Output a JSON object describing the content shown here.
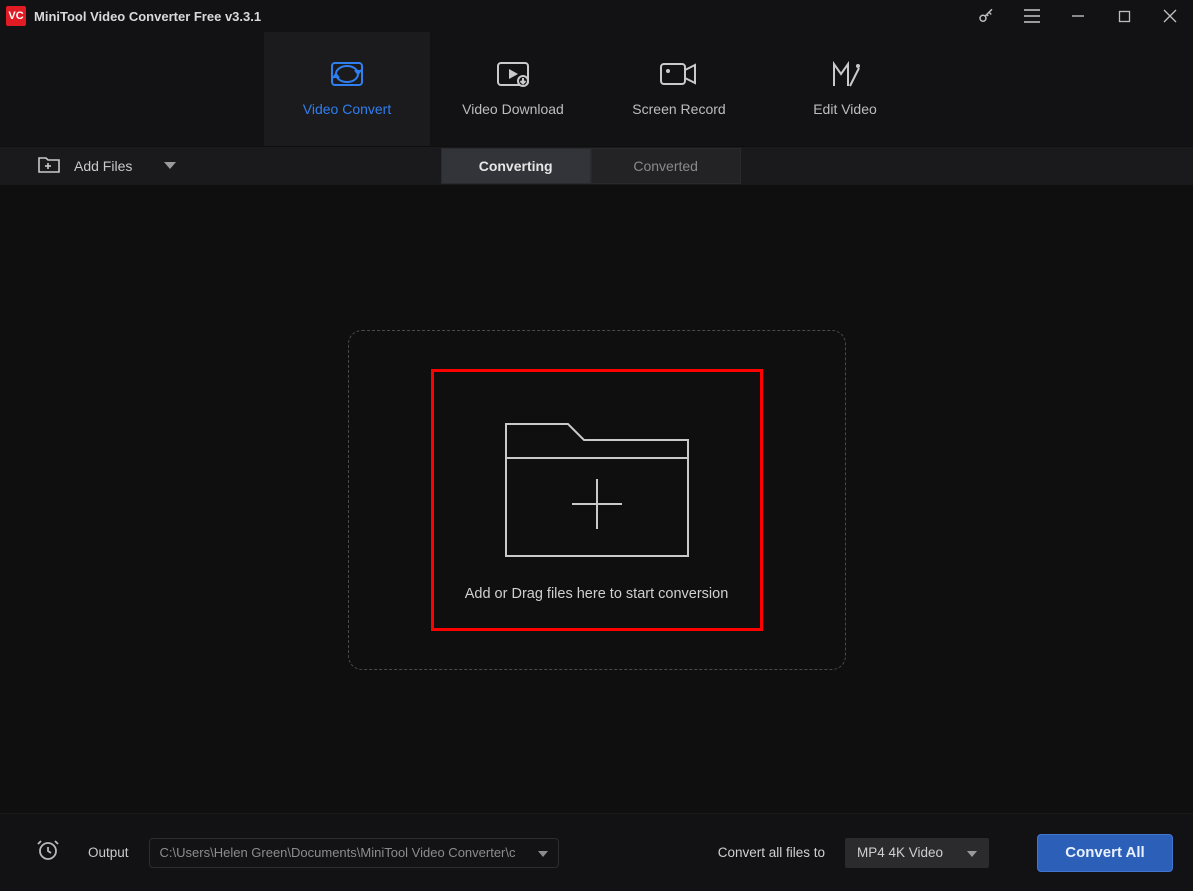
{
  "app": {
    "title": "MiniTool Video Converter Free v3.3.1"
  },
  "tabs": [
    {
      "label": "Video Convert"
    },
    {
      "label": "Video Download"
    },
    {
      "label": "Screen Record"
    },
    {
      "label": "Edit Video"
    }
  ],
  "toolbar": {
    "add_files_label": "Add Files",
    "segments": {
      "converting": "Converting",
      "converted": "Converted"
    }
  },
  "dropzone": {
    "text": "Add or Drag files here to start conversion"
  },
  "footer": {
    "output_label": "Output",
    "output_path": "C:\\Users\\Helen Green\\Documents\\MiniTool Video Converter\\c",
    "convert_all_files_to": "Convert all files to",
    "selected_format": "MP4 4K Video",
    "convert_all_button": "Convert All"
  }
}
